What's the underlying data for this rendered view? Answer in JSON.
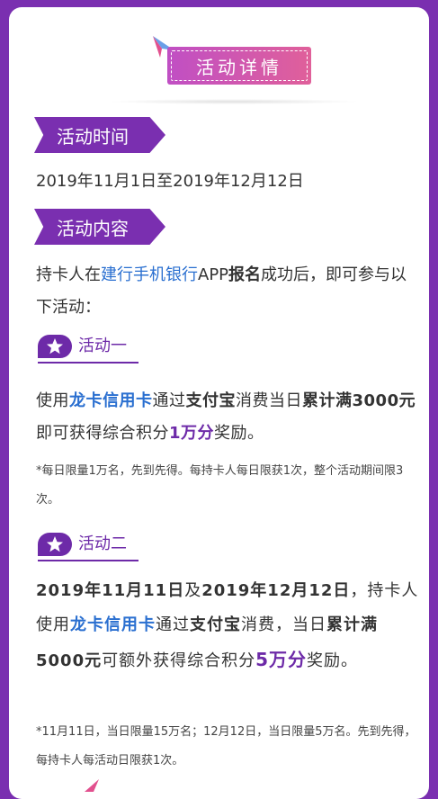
{
  "header": {
    "title": "活动详情"
  },
  "section_time": {
    "label": "活动时间",
    "date_range": "2019年11月1日至2019年12月12日"
  },
  "section_content": {
    "label": "活动内容",
    "intro": {
      "p1": "持卡人在",
      "bank_app": "建行手机银行",
      "p2": "APP",
      "signup": "报名",
      "p3": "成功后，即可参与以下活动："
    }
  },
  "activity_one": {
    "label": "活动一",
    "t1": "使用",
    "card": "龙卡信用卡",
    "t2": "通过",
    "alipay": "支付宝",
    "t3": "消费当日",
    "cumulative": "累计满3000元",
    "t4": "即可获得综合积分",
    "points": "1万分",
    "t5": "奖励。",
    "note": "*每日限量1万名，先到先得。每持卡人每日限获1次，整个活动期间限3次。"
  },
  "activity_two": {
    "label": "活动二",
    "date1": "2019年11月11日",
    "and": "及",
    "date2": "2019年12月12日",
    "t1": "，持卡人使用",
    "card": "龙卡信用卡",
    "t2": "通过",
    "alipay": "支付宝",
    "t3": "消费，当日",
    "cumulative": "累计满5000元",
    "t4": "可额外获得综合积分",
    "points": "5万分",
    "t5": "奖励。",
    "note": "*11月11日，当日限量15万名；12月12日，当日限量5万名。先到先得，每持卡人每活动日限获1次。"
  },
  "colors": {
    "purple": "#7a2fb0",
    "accent_purple": "#6d2aa8",
    "link_blue": "#2a6fd0"
  }
}
